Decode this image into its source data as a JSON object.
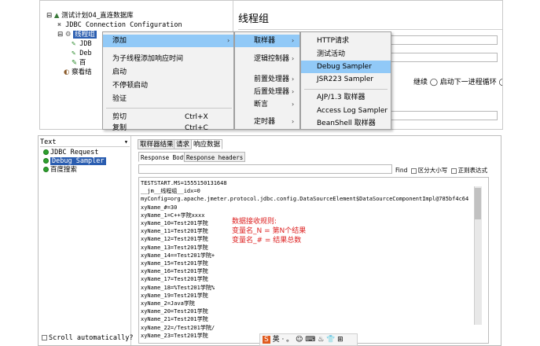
{
  "top": {
    "tree": [
      {
        "label": "测试计划04_直连数据库",
        "icon": "flask-icon"
      },
      {
        "label": "JDBC Connection Configuration",
        "icon": "wrench-icon"
      },
      {
        "label": "线程组",
        "icon": "gear-icon"
      },
      {
        "label": "JDB",
        "icon": "pencil-icon"
      },
      {
        "label": "Deb",
        "icon": "pencil-icon"
      },
      {
        "label": "百",
        "icon": "pencil-icon"
      },
      {
        "label": "察看结",
        "icon": "listener-icon"
      }
    ],
    "panel_title": "线程组",
    "radios_text": "继续   ◯ 启动下一进程循环  ◯ 停",
    "context_menu": {
      "items": [
        "添加",
        "为子线程添加响应时间",
        "启动",
        "不停顿启动",
        "验证",
        "剪切",
        "复制"
      ],
      "shortcuts": {
        "cut": "Ctrl+X",
        "copy": "Ctrl+C"
      }
    },
    "submenu": {
      "items": [
        "取样器",
        "逻辑控制器",
        "前置处理器",
        "后置处理器",
        "断言",
        "定时器"
      ]
    },
    "sampler_menu": {
      "items": [
        "HTTP请求",
        "测试活动",
        "Debug Sampler",
        "JSR223 Sampler",
        "AJP/1.3 取样器",
        "Access Log Sampler",
        "BeanShell 取样器"
      ]
    }
  },
  "bottom": {
    "tree_header": "Text",
    "tree": [
      "JDBC Request",
      "Debug Sampler",
      "百度搜索"
    ],
    "tabs": [
      "取样器结果",
      "请求",
      "响应数据"
    ],
    "subtabs": [
      "Response Body",
      "Response headers"
    ],
    "find_label": "Find",
    "case_label": "区分大小写",
    "regex_label": "正则表达式",
    "scroll_label": "Scroll automatically?",
    "lines": [
      "TESTSTART.MS=1555150131648",
      "__jm__线程组__idx=0",
      "myConfig=org.apache.jmeter.protocol.jdbc.config.DataSourceElement$DataSourceComponentImpl@785bf4c64",
      "xyName_#=30",
      "xyName_1=C++学院xxxx",
      "xyName_10=Test201学院",
      "xyName_11=Test201学院",
      "xyName_12=Test201学院",
      "xyName_13=Test201学院",
      "xyName_14==Test201学院+",
      "xyName_15=Test201学院",
      "xyName_16=Test201学院",
      "xyName_17=Test201学院",
      "xyName_18=%Test201学院%",
      "xyName_19=Test201学院",
      "xyName_2=Java学院",
      "xyName_20=Test201学院",
      "xyName_21=Test201学院",
      "xyName_22=/Test201学院/",
      "xyName_23=Test201学院"
    ],
    "note": [
      "数据接收规则:",
      "变量名_N  =  第N个结果",
      "变量名_#  =  结果总数"
    ],
    "ime": "英 · 。 ☺ ⌨ ♨ 👕 ⊞"
  }
}
